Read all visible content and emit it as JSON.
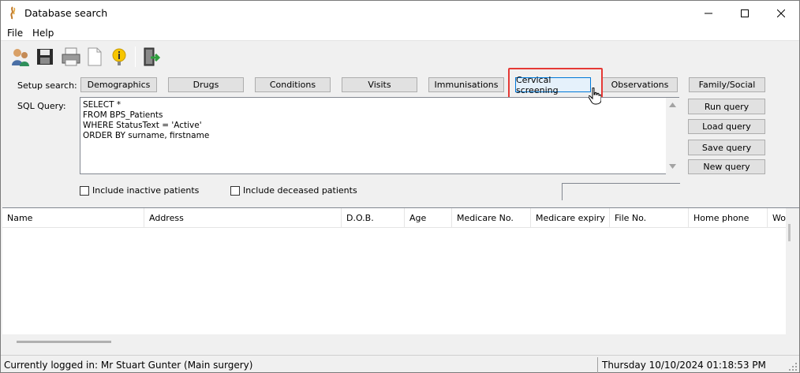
{
  "window": {
    "title": "Database search"
  },
  "menu": {
    "file": "File",
    "help": "Help"
  },
  "toolbar": {
    "icons": [
      "patients-icon",
      "save-icon",
      "print-icon",
      "new-document-icon",
      "info-icon",
      "exit-icon"
    ]
  },
  "setup": {
    "label": "Setup search:",
    "buttons": [
      "Demographics",
      "Drugs",
      "Conditions",
      "Visits",
      "Immunisations",
      "Cervical screening",
      "Observations",
      "Family/Social"
    ]
  },
  "sql": {
    "label": "SQL Query:",
    "text": "SELECT *\nFROM BPS_Patients\nWHERE StatusText = 'Active'\nORDER BY surname, firstname"
  },
  "actions": {
    "run": "Run query",
    "load": "Load query",
    "save": "Save query",
    "new": "New query"
  },
  "options": {
    "inactive": "Include inactive patients",
    "deceased": "Include deceased patients"
  },
  "grid": {
    "columns": [
      "Name",
      "Address",
      "D.O.B.",
      "Age",
      "Medicare No.",
      "Medicare expiry",
      "File No.",
      "Home phone",
      "Wo"
    ]
  },
  "status": {
    "logged_in": "Currently logged in:  Mr Stuart Gunter (Main surgery)",
    "datetime": "Thursday 10/10/2024 01:18:53 PM"
  },
  "colors": {
    "highlight": "#e53935",
    "focused_button": "#e5f1fb",
    "focus_border": "#0078d7"
  }
}
